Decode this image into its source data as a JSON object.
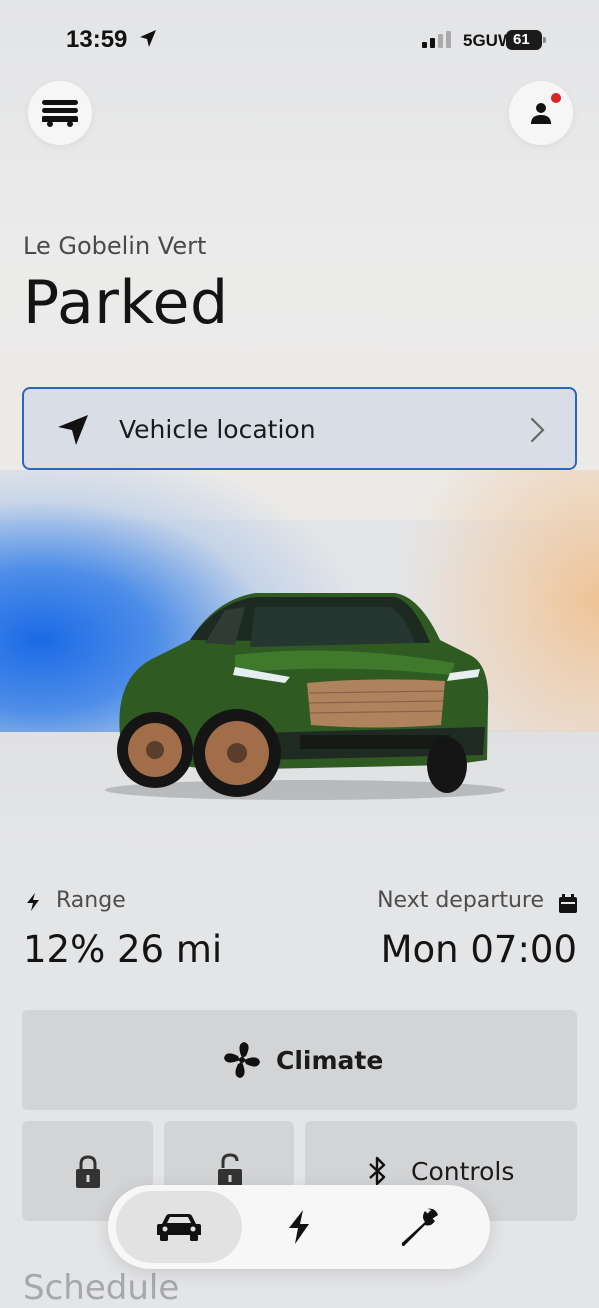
{
  "status_bar": {
    "time": "13:59",
    "network": "5GUW",
    "battery": "61"
  },
  "vehicle": {
    "name": "Le Gobelin Vert",
    "status": "Parked"
  },
  "location_card": {
    "label": "Vehicle location"
  },
  "range": {
    "label": "Range",
    "value": "12% 26 mi"
  },
  "next_departure": {
    "label": "Next departure",
    "value": "Mon 07:00"
  },
  "actions": {
    "climate_label": "Climate",
    "controls_label": "Controls"
  },
  "section": {
    "schedule_title": "Schedule"
  },
  "tabs": [
    {
      "icon": "car-icon",
      "selected": true
    },
    {
      "icon": "charge-icon",
      "selected": false
    },
    {
      "icon": "wrench-icon",
      "selected": false
    }
  ],
  "icons": {
    "menu": "garage-menu-icon",
    "profile": "person-icon",
    "location": "navigation-arrow-icon",
    "chevron": "chevron-right-icon",
    "range": "lightning-icon",
    "calendar": "calendar-icon",
    "climate": "fan-icon",
    "lock": "lock-icon",
    "unlock": "unlock-icon",
    "controls": "bluetooth-icon"
  },
  "colors": {
    "accent_border": "#2c66b8",
    "notification": "#d8231f",
    "car_body": "#2f5a22"
  }
}
